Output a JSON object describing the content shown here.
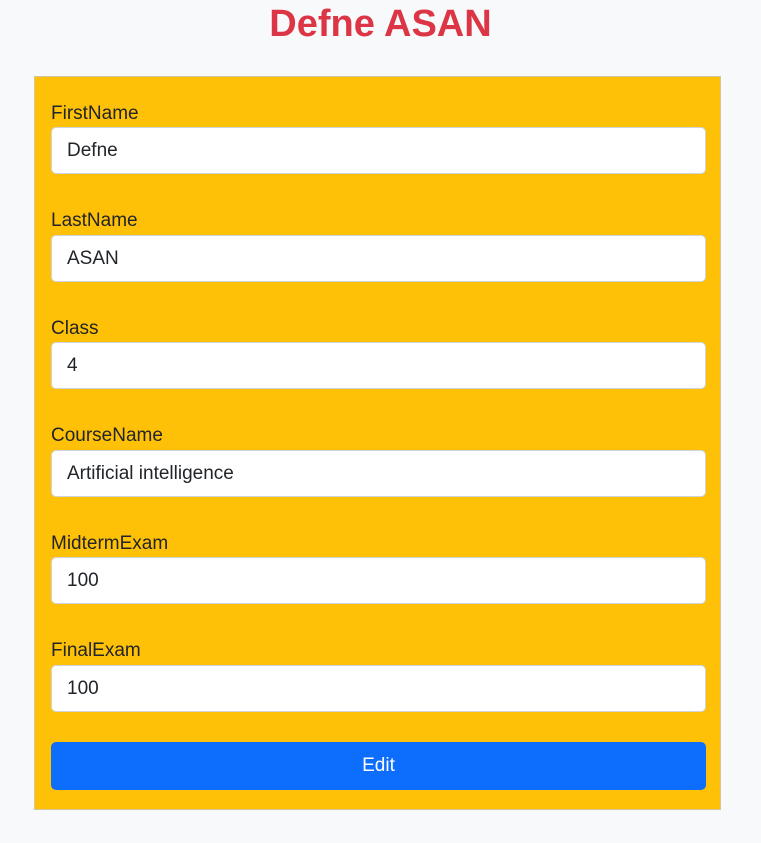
{
  "page": {
    "title": "Defne ASAN"
  },
  "form": {
    "fields": [
      {
        "label": "FirstName",
        "value": "Defne"
      },
      {
        "label": "LastName",
        "value": "ASAN"
      },
      {
        "label": "Class",
        "value": "4"
      },
      {
        "label": "CourseName",
        "value": "Artificial intelligence"
      },
      {
        "label": "MidtermExam",
        "value": "100"
      },
      {
        "label": "FinalExam",
        "value": "100"
      }
    ],
    "submit_label": "Edit"
  },
  "colors": {
    "page_background": "#f8f9fa",
    "title": "#dc3545",
    "form_background": "#ffc107",
    "button": "#0d6efd"
  }
}
